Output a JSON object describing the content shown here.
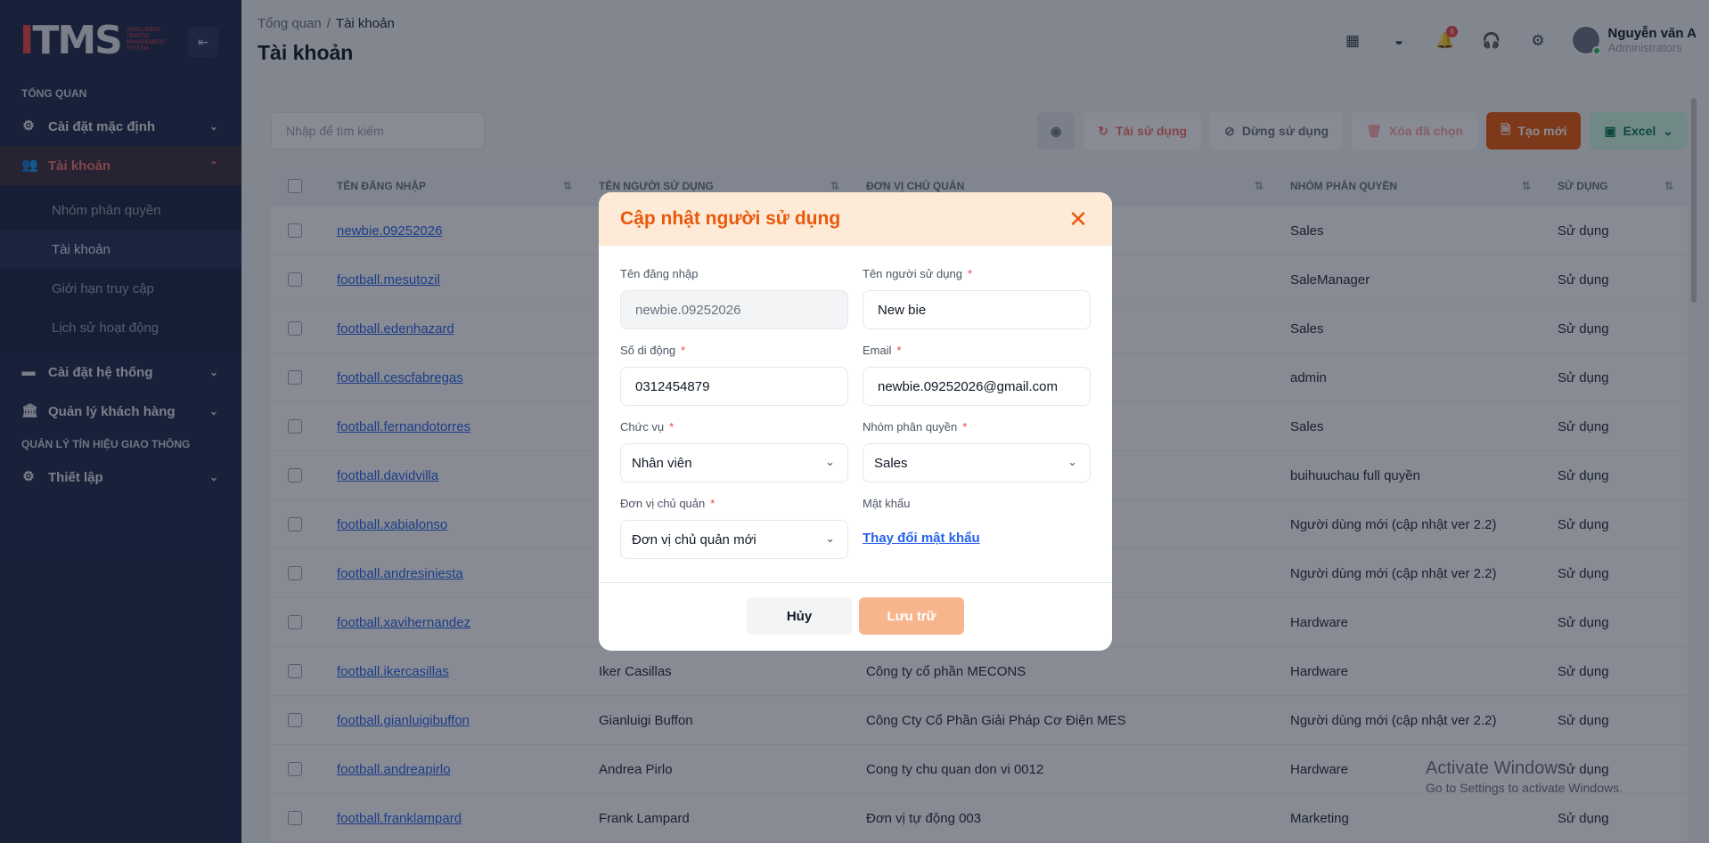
{
  "sidebar": {
    "logo_text": "ITMS",
    "logo_sub": "Intelligent Traffic Management System",
    "collapse_icon": "collapse-icon",
    "sections": {
      "overview": "TỔNG QUAN",
      "traffic": "QUẢN LÝ TÍN HIỆU GIAO THÔNG"
    },
    "items": [
      {
        "label": "Cài đặt mặc định",
        "icon": "gear-icon"
      },
      {
        "label": "Tài khoản",
        "icon": "users-icon"
      },
      {
        "label": "Cài đặt hệ thống",
        "icon": "window-icon"
      },
      {
        "label": "Quản lý khách hàng",
        "icon": "building-icon"
      },
      {
        "label": "Thiết lập",
        "icon": "gear-icon"
      }
    ],
    "subitems": [
      {
        "label": "Nhóm phân quyền"
      },
      {
        "label": "Tài khoản"
      },
      {
        "label": "Giới hạn truy cập"
      },
      {
        "label": "Lịch sử hoạt động"
      }
    ]
  },
  "header": {
    "breadcrumb_root": "Tổng quan",
    "breadcrumb_sep": "/",
    "breadcrumb_current": "Tài khoản",
    "title": "Tài khoản",
    "notification_count": "6",
    "user_name": "Nguyễn văn A",
    "user_role": "Administrators"
  },
  "toolbar": {
    "search_placeholder": "Nhập để tìm kiếm",
    "reuse": "Tái sử dụng",
    "stop": "Dừng sử dụng",
    "delete_selected": "Xóa đã chọn",
    "create": "Tạo mới",
    "excel": "Excel"
  },
  "table": {
    "columns": [
      "TÊN ĐĂNG NHẬP",
      "TÊN NGƯỜI SỬ DỤNG",
      "ĐƠN VỊ CHỦ QUẢN",
      "NHÓM PHÂN QUYỀN",
      "SỬ DỤNG"
    ],
    "rows": [
      {
        "username": "newbie.09252026",
        "name": "",
        "unit": "",
        "role": "Sales",
        "use": "Sử dụng"
      },
      {
        "username": "football.mesutozil",
        "name": "",
        "unit": "",
        "role": "SaleManager",
        "use": "Sử dụng"
      },
      {
        "username": "football.edenhazard",
        "name": "",
        "unit": "",
        "role": "Sales",
        "use": "Sử dụng"
      },
      {
        "username": "football.cescfabregas",
        "name": "",
        "unit": "",
        "role": "admin",
        "use": "Sử dụng"
      },
      {
        "username": "football.fernandotorres",
        "name": "",
        "unit": "",
        "role": "Sales",
        "use": "Sử dụng"
      },
      {
        "username": "football.davidvilla",
        "name": "",
        "unit": "",
        "role": "buihuuchau full quyền",
        "use": "Sử dụng"
      },
      {
        "username": "football.xabialonso",
        "name": "",
        "unit": "",
        "role": "Người dùng mới (cập nhật ver 2.2)",
        "use": "Sử dụng"
      },
      {
        "username": "football.andresiniesta",
        "name": "",
        "unit": "",
        "role": "Người dùng mới (cập nhật ver 2.2)",
        "use": "Sử dụng"
      },
      {
        "username": "football.xavihernandez",
        "name": "",
        "unit": "",
        "role": "Hardware",
        "use": "Sử dụng"
      },
      {
        "username": "football.ikercasillas",
        "name": "Iker Casillas",
        "unit": "Công ty cổ phần MECONS",
        "role": "Hardware",
        "use": "Sử dụng"
      },
      {
        "username": "football.gianluigibuffon",
        "name": "Gianluigi Buffon",
        "unit": "Công Cty Cổ Phần Giải Pháp Cơ Điện MES",
        "role": "Người dùng mới (cập nhật ver 2.2)",
        "use": "Sử dụng"
      },
      {
        "username": "football.andreapirlo",
        "name": "Andrea Pirlo",
        "unit": "Cong ty chu quan don vi 0012",
        "role": "Hardware",
        "use": "Sử dụng"
      },
      {
        "username": "football.franklampard",
        "name": "Frank Lampard",
        "unit": "Đơn vị tự động 003",
        "role": "Marketing",
        "use": "Sử dụng"
      }
    ]
  },
  "modal": {
    "title": "Cập nhật người sử dụng",
    "fields": {
      "username_label": "Tên đăng nhập",
      "username_value": "newbie.09252026",
      "fullname_label": "Tên người sử dụng",
      "fullname_value": "New bie",
      "phone_label": "Số di động",
      "phone_value": "0312454879",
      "email_label": "Email",
      "email_value": "newbie.09252026@gmail.com",
      "position_label": "Chức vụ",
      "position_value": "Nhân viên",
      "group_label": "Nhóm phân quyền",
      "group_value": "Sales",
      "unit_label": "Đơn vị chủ quản",
      "unit_value": "Đơn vị chủ quản mới",
      "password_label": "Mật khẩu",
      "password_link": "Thay đổi mật khẩu"
    },
    "required_mark": "*",
    "cancel": "Hủy",
    "save": "Lưu trữ"
  },
  "windows": {
    "line1": "Activate Windows",
    "line2": "Go to Settings to activate Windows."
  }
}
